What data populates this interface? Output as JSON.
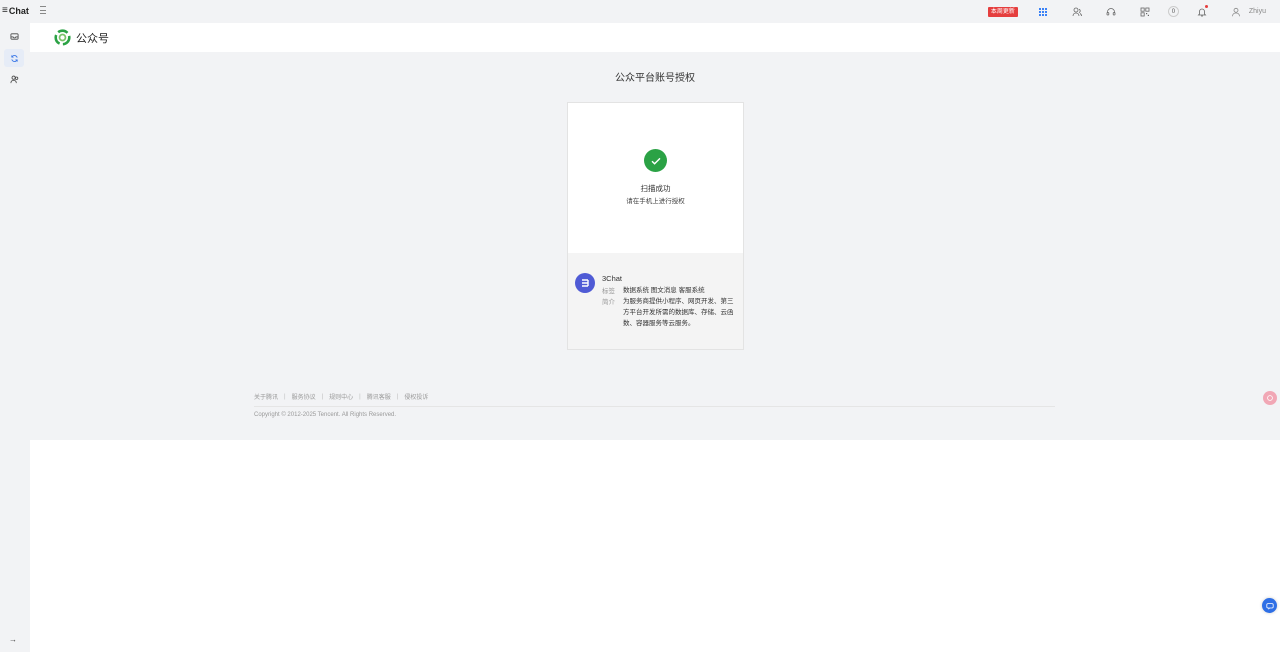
{
  "app": {
    "logo_text": "Chat",
    "logo_mark": "≡"
  },
  "topbar": {
    "update_badge": "本周更新",
    "counter": "0",
    "username": "Zhiyu"
  },
  "header": {
    "title": "公众号"
  },
  "main": {
    "title": "公众平台账号授权",
    "status_title": "扫描成功",
    "status_sub": "请在手机上进行授权",
    "account": {
      "name": "3Chat",
      "tag_label": "标签",
      "tag_value": "数据系统 图文消息 客服系统",
      "intro_label": "简介",
      "intro_value": "为服务商提供小程序、网页开发、第三方平台开发所需的数据库、存储、云函数、容器服务等云服务。"
    }
  },
  "footer": {
    "links": [
      "关于腾讯",
      "服务协议",
      "规则中心",
      "腾讯客服",
      "侵权投诉"
    ],
    "copyright": "Copyright © 2012-2025 Tencent. All Rights Reserved."
  },
  "colors": {
    "success": "#2ba245",
    "accent": "#3b82f6",
    "badge": "#e53e3e",
    "avatar": "#4f5bd5"
  }
}
